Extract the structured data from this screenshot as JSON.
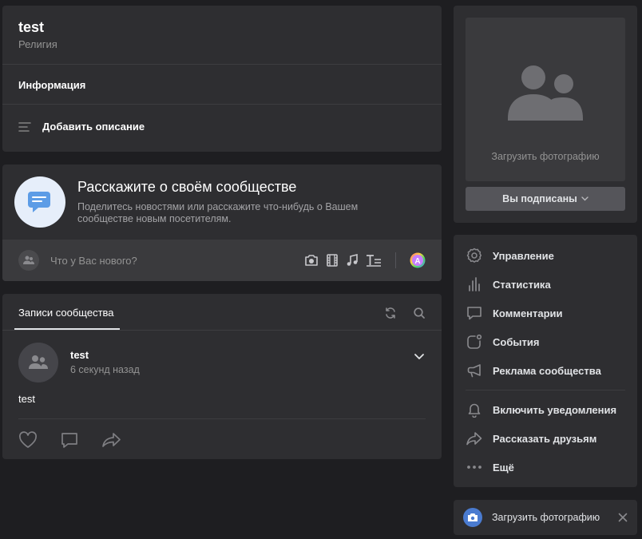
{
  "group": {
    "name": "test",
    "category": "Религия",
    "info_label": "Информация",
    "add_description_label": "Добавить описание"
  },
  "tell": {
    "title": "Расскажите о своём сообществе",
    "subtitle": "Поделитесь новостями или расскажите что-нибудь о Вашем сообществе новым посетителям."
  },
  "composer": {
    "placeholder": "Что у Вас нового?",
    "tools": [
      "camera-icon",
      "video-icon",
      "music-icon",
      "article-icon",
      "ai-avatar-icon"
    ]
  },
  "posts": {
    "tab_label": "Записи сообщества",
    "items": [
      {
        "author": "test",
        "time": "6 секунд назад",
        "text": "test"
      }
    ]
  },
  "photo": {
    "upload_label": "Загрузить фотографию",
    "subscribed_label": "Вы подписаны"
  },
  "menu": {
    "items": [
      {
        "label": "Управление",
        "icon": "gear-icon"
      },
      {
        "label": "Статистика",
        "icon": "stats-icon"
      },
      {
        "label": "Комментарии",
        "icon": "comment-icon"
      },
      {
        "label": "События",
        "icon": "events-icon"
      },
      {
        "label": "Реклама сообщества",
        "icon": "megaphone-icon"
      }
    ],
    "items2": [
      {
        "label": "Включить уведомления",
        "icon": "bell-icon"
      },
      {
        "label": "Рассказать друзьям",
        "icon": "share-icon"
      },
      {
        "label": "Ещё",
        "icon": "more-icon"
      }
    ]
  },
  "toast": {
    "label": "Загрузить фотографию"
  },
  "colors": {
    "background": "#1e1e21",
    "card": "#2e2e31",
    "accent": "#4a7bd0",
    "text": "#e1e3e6",
    "muted": "#939393"
  }
}
